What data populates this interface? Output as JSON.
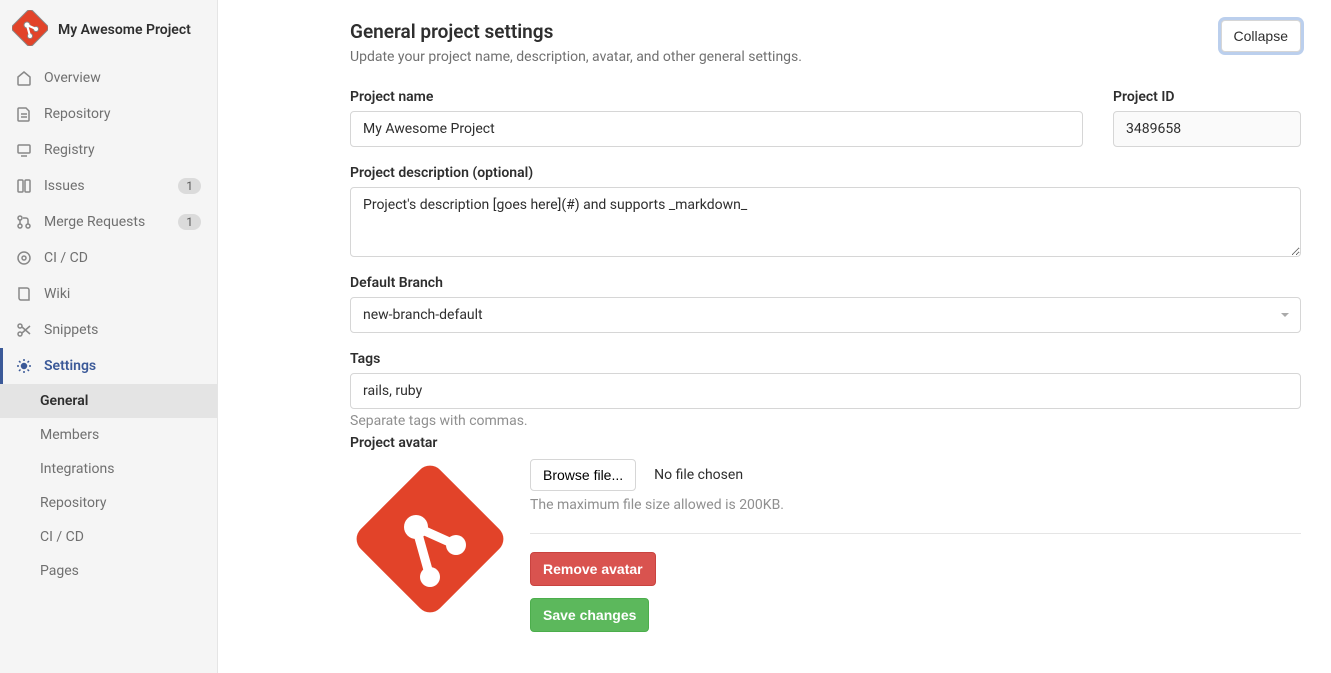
{
  "sidebar": {
    "project_name": "My Awesome Project",
    "items": [
      {
        "label": "Overview"
      },
      {
        "label": "Repository"
      },
      {
        "label": "Registry"
      },
      {
        "label": "Issues",
        "badge": "1"
      },
      {
        "label": "Merge Requests",
        "badge": "1"
      },
      {
        "label": "CI / CD"
      },
      {
        "label": "Wiki"
      },
      {
        "label": "Snippets"
      },
      {
        "label": "Settings"
      }
    ],
    "sub_items": [
      {
        "label": "General"
      },
      {
        "label": "Members"
      },
      {
        "label": "Integrations"
      },
      {
        "label": "Repository"
      },
      {
        "label": "CI / CD"
      },
      {
        "label": "Pages"
      }
    ]
  },
  "header": {
    "title": "General project settings",
    "subtitle": "Update your project name, description, avatar, and other general settings.",
    "collapse": "Collapse"
  },
  "form": {
    "name_label": "Project name",
    "name_value": "My Awesome Project",
    "id_label": "Project ID",
    "id_value": "3489658",
    "desc_label": "Project description (optional)",
    "desc_value": "Project's description [goes here](#) and supports _markdown_",
    "branch_label": "Default Branch",
    "branch_value": "new-branch-default",
    "tags_label": "Tags",
    "tags_value": "rails, ruby",
    "tags_help": "Separate tags with commas.",
    "avatar_label": "Project avatar",
    "browse_label": "Browse file...",
    "no_file": "No file chosen",
    "avatar_help": "The maximum file size allowed is 200KB.",
    "remove_avatar": "Remove avatar",
    "save": "Save changes"
  }
}
